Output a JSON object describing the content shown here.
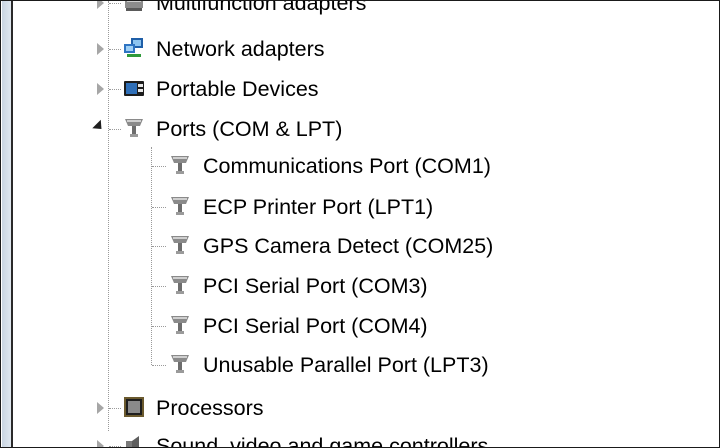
{
  "tree": {
    "items": [
      {
        "label": "Multifunction adapters",
        "icon": "multifunction-adapter-icon",
        "state": "collapsed"
      },
      {
        "label": "Network adapters",
        "icon": "network-adapter-icon",
        "state": "collapsed"
      },
      {
        "label": "Portable Devices",
        "icon": "portable-devices-icon",
        "state": "collapsed"
      },
      {
        "label": "Ports (COM & LPT)",
        "icon": "port-connector-icon",
        "state": "expanded",
        "children": [
          {
            "label": "Communications Port (COM1)",
            "icon": "port-connector-icon"
          },
          {
            "label": "ECP Printer Port (LPT1)",
            "icon": "port-connector-icon"
          },
          {
            "label": "GPS Camera Detect (COM25)",
            "icon": "port-connector-icon"
          },
          {
            "label": "PCI Serial Port (COM3)",
            "icon": "port-connector-icon"
          },
          {
            "label": "PCI Serial Port (COM4)",
            "icon": "port-connector-icon"
          },
          {
            "label": "Unusable Parallel Port (LPT3)",
            "icon": "port-connector-icon"
          }
        ]
      },
      {
        "label": "Processors",
        "icon": "processor-icon",
        "state": "collapsed"
      },
      {
        "label": "Sound, video and game controllers",
        "icon": "speaker-icon",
        "state": "collapsed"
      }
    ]
  },
  "colors": {
    "icon_blue": "#1f5fa8",
    "port_gray": "#7d7d7d",
    "processor_brown": "#6b5a2e"
  }
}
